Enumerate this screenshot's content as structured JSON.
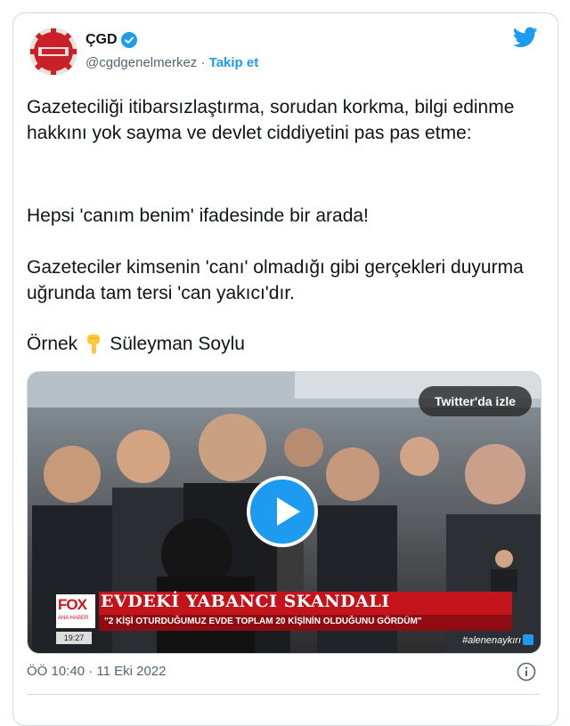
{
  "account": {
    "name": "ÇGD",
    "handle": "@cgdgenelmerkez",
    "separator": "·",
    "follow_label": "Takip et"
  },
  "tweet": {
    "paragraph1": "Gazeteciliği itibarsızlaştırma, sorudan korkma, bilgi edinme hakkını yok sayma ve devlet ciddiyetini pas pas etme:",
    "paragraph2": "Hepsi 'canım benim' ifadesinde bir arada!",
    "paragraph3": "Gazeteciler kimsenin 'canı' olmadığı gibi gerçekleri duyurma uğrunda tam tersi 'can yakıcı'dır.",
    "paragraph4_before": "Örnek",
    "paragraph4_after": "Süleyman Soylu"
  },
  "media": {
    "watch_label": "Twitter'da izle",
    "channel_logo": "FOX",
    "channel_sub": "ANA HABER",
    "headline": "EVDEKİ YABANCI SKANDALI",
    "subline": "\"2 KİŞİ OTURDUĞUMUZ EVDE TOPLAM 20 KİŞİNİN OLDUĞUNU GÖRDÜM\"",
    "clock": "19:27",
    "hashtag": "#alenenaykırı"
  },
  "footer": {
    "timestamp": "ÖÖ 10:40 · 11 Eki 2022"
  },
  "icons": {
    "verified": "verified-badge-icon",
    "bird": "twitter-bird-icon",
    "pointing": "pointing-down-emoji-icon",
    "play": "play-icon",
    "info": "info-icon"
  },
  "colors": {
    "accent": "#1d9bf0",
    "text": "#0f1419",
    "secondary": "#536471",
    "headline_red": "#c4141b"
  }
}
